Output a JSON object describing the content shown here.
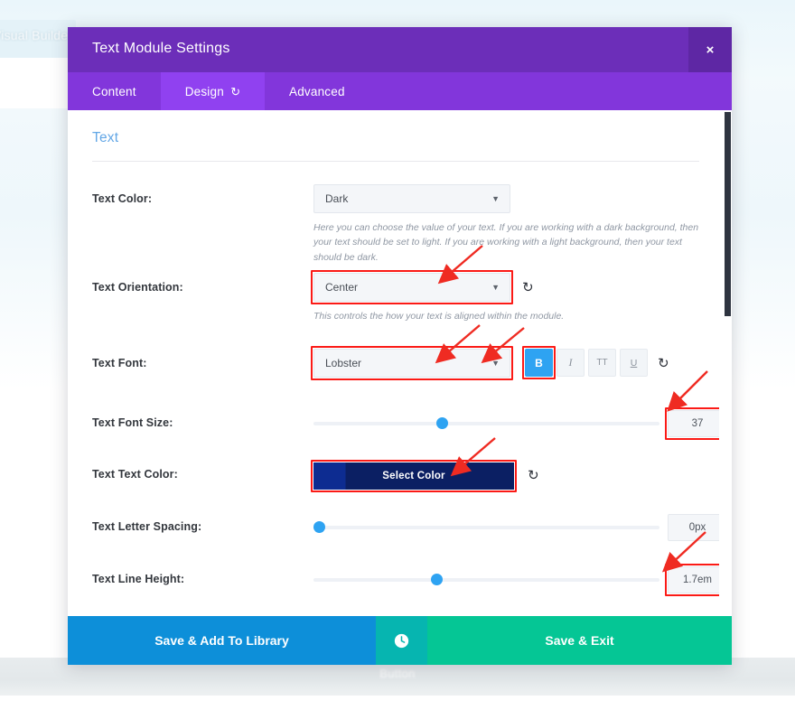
{
  "background": {
    "visual_builder_label": "Visual Builder",
    "button_label": "Button"
  },
  "modal": {
    "title": "Text Module Settings",
    "close_label": "×",
    "tabs": [
      {
        "label": "Content",
        "active": false
      },
      {
        "label": "Design",
        "active": true,
        "reset_icon": "↺"
      },
      {
        "label": "Advanced",
        "active": false
      }
    ],
    "section_title": "Text",
    "fields": [
      {
        "key": "text_color",
        "label": "Text Color:",
        "type": "select",
        "value": "Dark",
        "caret": "▼",
        "highlighted": false,
        "description": "Here you can choose the value of your text. If you are working with a dark background, then your text should be set to light. If you are working with a light background, then your text should be dark."
      },
      {
        "key": "text_orientation",
        "label": "Text Orientation:",
        "type": "select",
        "value": "Center",
        "caret": "▼",
        "highlighted": true,
        "reset_icon": "↺",
        "description": "This controls the how your text is aligned within the module."
      },
      {
        "key": "text_font",
        "label": "Text Font:",
        "type": "select",
        "value": "Lobster",
        "caret": "▼",
        "highlighted": true,
        "reset_icon": "↺",
        "style_buttons": [
          {
            "name": "bold",
            "label": "B",
            "active": true,
            "highlighted": true
          },
          {
            "name": "italic",
            "label": "I",
            "active": false,
            "highlighted": false
          },
          {
            "name": "uppercase",
            "label": "TT",
            "active": false,
            "highlighted": false
          },
          {
            "name": "underline",
            "label": "U",
            "active": false,
            "highlighted": false
          }
        ]
      },
      {
        "key": "text_font_size",
        "label": "Text Font Size:",
        "type": "slider",
        "value": "37",
        "handle_percent": 37,
        "highlighted": true,
        "reset_icon": "↺",
        "has_mobile_icon": true
      },
      {
        "key": "text_text_color",
        "label": "Text Text Color:",
        "type": "color",
        "value": "Select Color",
        "color": "#0b1f63",
        "accent_color": "#0d2c91",
        "highlighted": true,
        "reset_icon": "↺"
      },
      {
        "key": "text_letter_spacing",
        "label": "Text Letter Spacing:",
        "type": "slider",
        "value": "0px",
        "handle_percent": 0,
        "highlighted": false
      },
      {
        "key": "text_line_height",
        "label": "Text Line Height:",
        "type": "slider",
        "value": "1.7em",
        "handle_percent": 35,
        "highlighted": true
      }
    ],
    "footer": {
      "save_library_label": "Save & Add To Library",
      "history_icon": "history-icon",
      "save_exit_label": "Save & Exit"
    }
  },
  "colors": {
    "header_purple": "#6c2eb9",
    "tab_purple": "#8236db",
    "tab_active_purple": "#9041f0",
    "accent_blue": "#2ea3f2",
    "section_title_blue": "#63a7e6",
    "highlight_red": "#fb1a16",
    "save_library_blue": "#0d8fd9",
    "history_teal": "#06b5b0",
    "save_exit_green": "#05c695"
  }
}
